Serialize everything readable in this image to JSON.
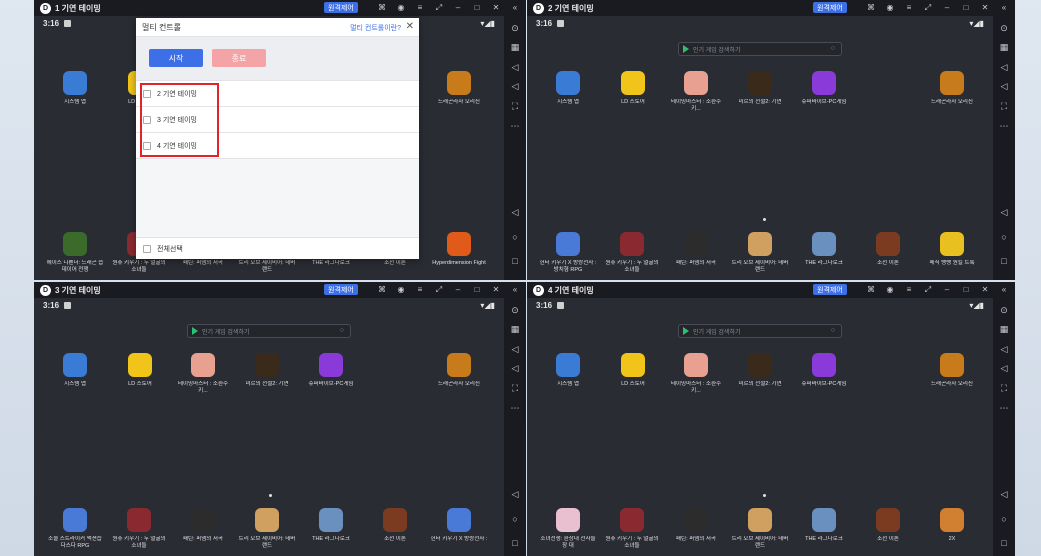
{
  "windows": [
    {
      "title": "1 기연 테이밍",
      "remote_label": "원격제어",
      "time": "3:16",
      "search_placeholder": "",
      "apps": [
        {
          "label": "시스템 앱",
          "color": "#3a7bd5"
        },
        {
          "label": "LD 스토어",
          "color": "#f0c419"
        },
        {
          "label": "드래곤라자 오리진",
          "color": "#c77b1a"
        }
      ],
      "bottom_apps": [
        {
          "label": "에이스 디펜더: 드래곤 습데이어 전쟁",
          "color": "#3b6b2a"
        },
        {
          "label": "원츄 키우기 : 두 얼굴의 소녀들",
          "color": "#8a2a30"
        },
        {
          "label": "패틴: 퍼뎀의 서곡",
          "color": "#2c2c2c"
        },
        {
          "label": "트리 오브 세이비어: 네버랜드",
          "color": "#d0a060"
        },
        {
          "label": "THE 라그나로크",
          "color": "#6a90c0"
        },
        {
          "label": "조선 이론",
          "color": "#7a3b20"
        },
        {
          "label": "Hyperdimension Fight",
          "color": "#e05a1a"
        }
      ]
    },
    {
      "title": "2 기연 테이밍",
      "remote_label": "원격제어",
      "time": "3:16",
      "search_placeholder": "인기 게임 검색하기",
      "apps": [
        {
          "label": "시스템 앱",
          "color": "#3a7bd5"
        },
        {
          "label": "LD 스토어",
          "color": "#f0c419"
        },
        {
          "label": "테이밍마스터 : 소환수 키...",
          "color": "#e8a090"
        },
        {
          "label": "미르의 전설2: 기연",
          "color": "#3a2a1a"
        },
        {
          "label": "슈퍼바이브-PC게임",
          "color": "#8a3ad8"
        },
        {
          "label": "드래곤라자 오리진",
          "color": "#c77b1a"
        }
      ],
      "bottom_apps": [
        {
          "label": "헌터 키우기 X 방랑전사 : 방치형 RPG",
          "color": "#4a7ad8"
        },
        {
          "label": "원츄 키우기 : 두 얼굴의 소녀들",
          "color": "#8a2a30"
        },
        {
          "label": "패틴: 퍼뎀의 서곡",
          "color": "#2c2c2c"
        },
        {
          "label": "트리 오브 세이비어: 네버랜드",
          "color": "#d0a060"
        },
        {
          "label": "THE 라그나로크",
          "color": "#6a90c0"
        },
        {
          "label": "조선 이론",
          "color": "#7a3b20"
        },
        {
          "label": "메직 뱅뱅 원킬 트룩",
          "color": "#e8c020"
        }
      ]
    },
    {
      "title": "3 기연 테이밍",
      "remote_label": "원격제어",
      "time": "3:16",
      "search_placeholder": "인기 게임 검색하기",
      "apps": [
        {
          "label": "시스템 앱",
          "color": "#3a7bd5"
        },
        {
          "label": "LD 스토어",
          "color": "#f0c419"
        },
        {
          "label": "테이밍마스터 : 소환수 키...",
          "color": "#e8a090"
        },
        {
          "label": "미르의 전설2: 기연",
          "color": "#3a2a1a"
        },
        {
          "label": "슈퍼바이브-PC게임",
          "color": "#8a3ad8"
        },
        {
          "label": "드래곤라자 오리진",
          "color": "#c77b1a"
        }
      ],
      "bottom_apps": [
        {
          "label": "소울 스트라이커 액션습 다스다 RPG",
          "color": "#4a7ad8"
        },
        {
          "label": "원츄 키우기 : 두 얼굴의 소녀들",
          "color": "#8a2a30"
        },
        {
          "label": "패틴: 퍼뎀의 서곡",
          "color": "#2c2c2c"
        },
        {
          "label": "트리 오브 세이비어: 네버랜드",
          "color": "#d0a060"
        },
        {
          "label": "THE 라그나로크",
          "color": "#6a90c0"
        },
        {
          "label": "조선 이론",
          "color": "#7a3b20"
        },
        {
          "label": "헌터 키우기 X 방랑전사 :",
          "color": "#4a7ad8"
        }
      ]
    },
    {
      "title": "4 기연 테이밍",
      "remote_label": "원격제어",
      "time": "3:16",
      "search_placeholder": "인기 게임 검색하기",
      "apps": [
        {
          "label": "시스템 앱",
          "color": "#3a7bd5"
        },
        {
          "label": "LD 스토어",
          "color": "#f0c419"
        },
        {
          "label": "테이밍마스터 : 소환수 키...",
          "color": "#e8a090"
        },
        {
          "label": "미르의 전설2: 기연",
          "color": "#3a2a1a"
        },
        {
          "label": "슈퍼바이브-PC게임",
          "color": "#8a3ad8"
        },
        {
          "label": "드래곤라자 오리진",
          "color": "#c77b1a"
        }
      ],
      "bottom_apps": [
        {
          "label": "소녀전쟁: 환상대 천사들장 대",
          "color": "#e8c0d0"
        },
        {
          "label": "원츄 키우기 : 두 얼굴의 소녀들",
          "color": "#8a2a30"
        },
        {
          "label": "패틴: 퍼뎀의 서곡",
          "color": "#2c2c2c"
        },
        {
          "label": "트리 오브 세이비어: 네버랜드",
          "color": "#d0a060"
        },
        {
          "label": "THE 라그나로크",
          "color": "#6a90c0"
        },
        {
          "label": "조선 이론",
          "color": "#7a3b20"
        },
        {
          "label": "2X",
          "color": "#d08030"
        }
      ]
    }
  ],
  "dialog": {
    "title": "멀티 컨트롤",
    "help_link": "멀티 컨트롤이란?",
    "start_label": "시작",
    "stop_label": "종료",
    "instances": [
      "2 기연 테이밍",
      "3 기연 테이밍",
      "4 기연 테이밍"
    ],
    "select_all": "전체선택"
  },
  "colors": {
    "accent": "#3d6fe6",
    "stop": "#f4a3a6",
    "highlight": "#e0242a"
  }
}
